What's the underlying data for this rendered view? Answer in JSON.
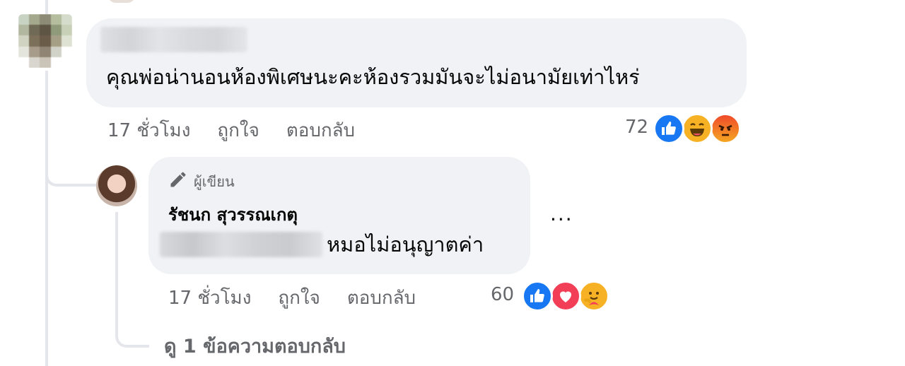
{
  "comment": {
    "text": "คุณพ่อน่านอนห้องพิเศษนะคะห้องรวมมันจะไม่อนามัยเท่าไหร่",
    "time": "17 ชั่วโมง",
    "like_label": "ถูกใจ",
    "reply_label": "ตอบกลับ",
    "reaction_count": "72",
    "reactions": [
      "like-icon",
      "haha-icon",
      "angry-icon"
    ]
  },
  "reply": {
    "author_badge": "ผู้เขียน",
    "author_name": "รัชนก สุวรรณเกตุ",
    "text_visible": "หมอไม่อนุญาตค่า",
    "more_label": "...",
    "time": "17 ชั่วโมง",
    "like_label": "ถูกใจ",
    "reply_label": "ตอบกลับ",
    "reaction_count": "60",
    "reactions": [
      "like-icon",
      "love-icon",
      "care-icon"
    ]
  },
  "view_replies": "ดู 1 ข้อความตอบกลับ",
  "colors": {
    "bubble": "#f0f2f5",
    "meta_text": "#65676b",
    "like_blue": "#1877f2",
    "haha_yellow": "#f7b125",
    "angry_red": "#e9710f",
    "love_red": "#f33e58"
  }
}
